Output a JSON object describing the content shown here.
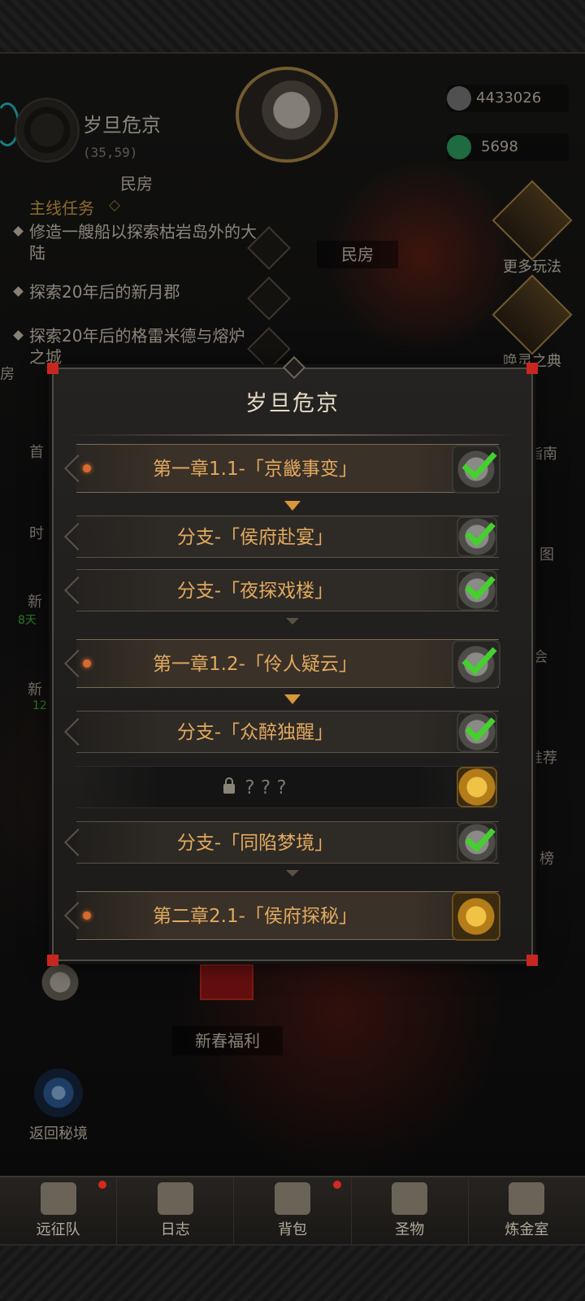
{
  "header": {
    "location_name": "岁旦危京",
    "coordinates": "(35,59)",
    "area_name": "民房",
    "resources": [
      {
        "icon": "silver-coin-icon",
        "value": "4433026"
      },
      {
        "icon": "green-gem-icon",
        "value": "5698"
      }
    ]
  },
  "quests": {
    "heading": "主线任务",
    "items": [
      {
        "text": "修造一艘船以探索枯岩岛外的大陆"
      },
      {
        "text": "探索20年后的新月郡"
      },
      {
        "text": "探索20年后的格雷米德与熔炉之城"
      }
    ]
  },
  "scene": {
    "area_tag": "民房",
    "left_partial": [
      "房",
      "首",
      "时",
      "新",
      "8天",
      "新",
      "12"
    ]
  },
  "right_menu": [
    {
      "label": "更多玩法",
      "icon": "gift-box-icon"
    },
    {
      "label": "唤灵之典",
      "icon": "tome-icon"
    }
  ],
  "right_partial": [
    "指南",
    "图",
    "会",
    "推荐",
    "榜"
  ],
  "modal": {
    "title": "岁旦危京",
    "rows": [
      {
        "type": "chapter",
        "label": "第一章1.1-「京畿事变」",
        "status": "done"
      },
      {
        "type": "branch",
        "label": "分支-「侯府赴宴」",
        "status": "done"
      },
      {
        "type": "branch",
        "label": "分支-「夜探戏楼」",
        "status": "done"
      },
      {
        "type": "chapter",
        "label": "第一章1.2-「伶人疑云」",
        "status": "done"
      },
      {
        "type": "branch",
        "label": "分支-「众醉独醒」",
        "status": "done"
      },
      {
        "type": "locked",
        "label": "? ? ?",
        "status": "reward"
      },
      {
        "type": "branch",
        "label": "分支-「同陷梦境」",
        "status": "done"
      },
      {
        "type": "chapter",
        "label": "第二章2.1-「侯府探秘」",
        "status": "reward"
      }
    ]
  },
  "bottom_left": {
    "welfare_label": "新春福利",
    "return_label": "返回秘境"
  },
  "nav": [
    {
      "label": "远征队",
      "icon": "viking-helmet-icon",
      "dot": true
    },
    {
      "label": "日志",
      "icon": "scroll-map-icon",
      "dot": false
    },
    {
      "label": "背包",
      "icon": "backpack-icon",
      "dot": true
    },
    {
      "label": "圣物",
      "icon": "chalice-icon",
      "dot": false
    },
    {
      "label": "炼金室",
      "icon": "alchemy-icon",
      "dot": false
    }
  ]
}
